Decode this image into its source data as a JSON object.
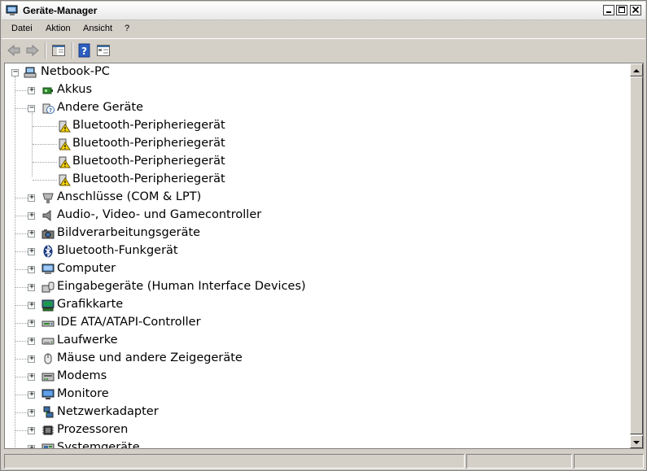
{
  "window": {
    "title": "Geräte-Manager"
  },
  "menu": [
    "Datei",
    "Aktion",
    "Ansicht",
    "?"
  ],
  "tree": {
    "root": "Netbook-PC",
    "categories": [
      {
        "label": "Akkus",
        "icon": "battery-icon",
        "expanded": false
      },
      {
        "label": "Andere Geräte",
        "icon": "unknown-device-icon",
        "expanded": true,
        "children": [
          "Bluetooth-Peripheriegerät",
          "Bluetooth-Peripheriegerät",
          "Bluetooth-Peripheriegerät",
          "Bluetooth-Peripheriegerät"
        ]
      },
      {
        "label": "Anschlüsse (COM & LPT)",
        "icon": "port-icon",
        "expanded": false
      },
      {
        "label": "Audio-, Video- und Gamecontroller",
        "icon": "speaker-icon",
        "expanded": false
      },
      {
        "label": "Bildverarbeitungsgeräte",
        "icon": "camera-icon",
        "expanded": false
      },
      {
        "label": "Bluetooth-Funkgerät",
        "icon": "bluetooth-icon",
        "expanded": false
      },
      {
        "label": "Computer",
        "icon": "computer-icon",
        "expanded": false
      },
      {
        "label": "Eingabegeräte (Human Interface Devices)",
        "icon": "hid-icon",
        "expanded": false
      },
      {
        "label": "Grafikkarte",
        "icon": "display-adapter-icon",
        "expanded": false
      },
      {
        "label": "IDE ATA/ATAPI-Controller",
        "icon": "ide-controller-icon",
        "expanded": false
      },
      {
        "label": "Laufwerke",
        "icon": "disk-drive-icon",
        "expanded": false
      },
      {
        "label": "Mäuse und andere Zeigegeräte",
        "icon": "mouse-icon",
        "expanded": false
      },
      {
        "label": "Modems",
        "icon": "modem-icon",
        "expanded": false
      },
      {
        "label": "Monitore",
        "icon": "monitor-icon",
        "expanded": false
      },
      {
        "label": "Netzwerkadapter",
        "icon": "network-adapter-icon",
        "expanded": false
      },
      {
        "label": "Prozessoren",
        "icon": "processor-icon",
        "expanded": false
      },
      {
        "label": "Systemgeräte",
        "icon": "system-devices-icon",
        "expanded": false
      }
    ]
  },
  "symbols": {
    "collapsed": "+",
    "expanded": "−"
  }
}
